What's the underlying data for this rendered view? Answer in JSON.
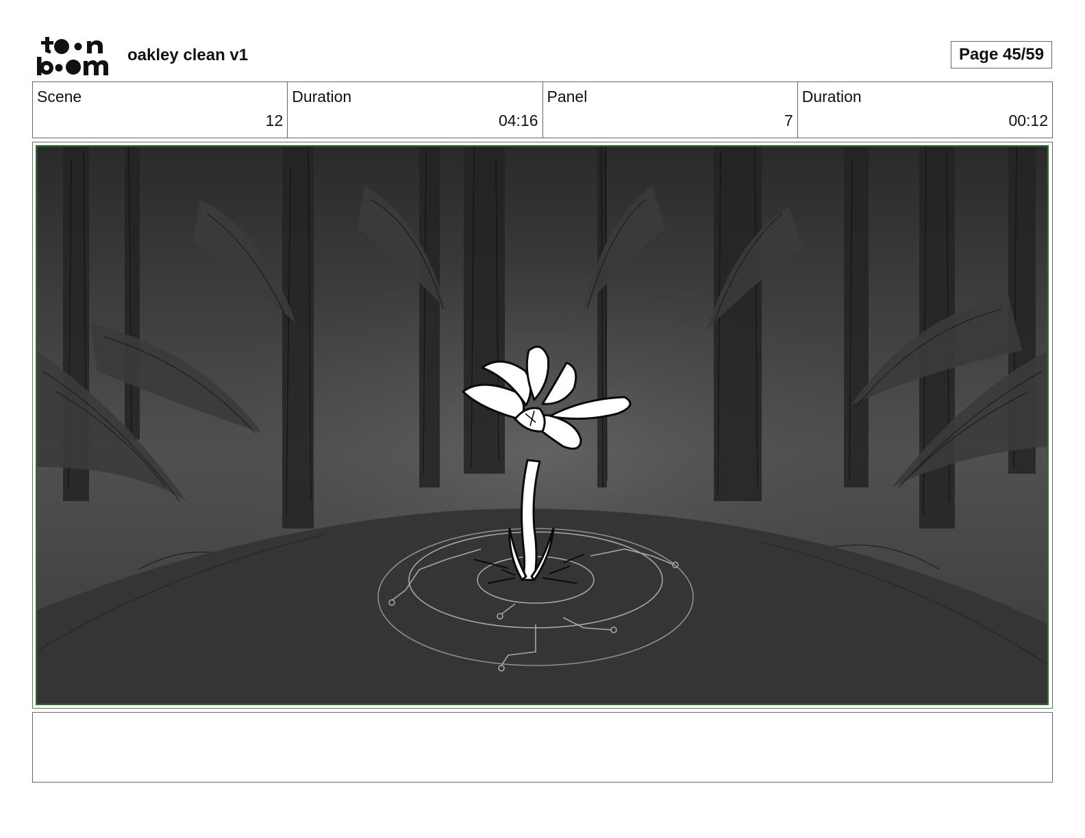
{
  "header": {
    "logo_icon": "toon-boom-logo-icon",
    "project_title": "oakley clean v1",
    "page_counter": "Page 45/59"
  },
  "info_bar": {
    "scene": {
      "label": "Scene",
      "value": "12"
    },
    "scene_duration": {
      "label": "Duration",
      "value": "04:16"
    },
    "panel": {
      "label": "Panel",
      "value": "7"
    },
    "panel_duration": {
      "label": "Duration",
      "value": "00:12"
    }
  },
  "panel_image": {
    "frame_border_color": "#2e6b2e",
    "sky_color": "#2c2c2c",
    "ground_color": "#353535",
    "flower_color": "#ffffff"
  },
  "notes": {
    "text": ""
  }
}
